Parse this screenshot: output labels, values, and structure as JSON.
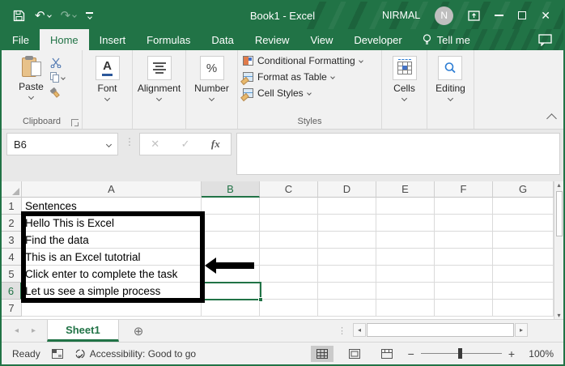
{
  "colors": {
    "accent": "#217346",
    "annotation": "#000000"
  },
  "titlebar": {
    "title": "Book1  -  Excel",
    "user": "NIRMAL",
    "avatar": "N"
  },
  "tabs": {
    "items": [
      "File",
      "Home",
      "Insert",
      "Formulas",
      "Data",
      "Review",
      "View",
      "Developer"
    ],
    "active": "Home",
    "tell_me": "Tell me"
  },
  "ribbon": {
    "paste": "Paste",
    "clipboard": "Clipboard",
    "font": "Font",
    "font_glyph": "A",
    "alignment": "Alignment",
    "number": "Number",
    "number_glyph": "%",
    "styles_items": [
      "Conditional Formatting",
      "Format as Table",
      "Cell Styles"
    ],
    "styles": "Styles",
    "cells": "Cells",
    "editing": "Editing"
  },
  "formula": {
    "name_box": "B6",
    "fx_label": "fx",
    "value": ""
  },
  "grid": {
    "columns": [
      "A",
      "B",
      "C",
      "D",
      "E",
      "F",
      "G"
    ],
    "active_column": "B",
    "active_row": "6",
    "rows": [
      {
        "num": "1",
        "a": "Sentences"
      },
      {
        "num": "2",
        "a": "Hello This is Excel"
      },
      {
        "num": "3",
        "a": "Find the data"
      },
      {
        "num": "4",
        "a": "This is an Excel tutotrial"
      },
      {
        "num": "5",
        "a": "Click enter to complete the task"
      },
      {
        "num": "6",
        "a": "Let us see a simple process"
      },
      {
        "num": "7",
        "a": ""
      }
    ]
  },
  "sheetbar": {
    "sheet": "Sheet1"
  },
  "statusbar": {
    "mode": "Ready",
    "accessibility": "Accessibility: Good to go",
    "zoom_minus": "−",
    "zoom_plus": "+",
    "zoom_level": "100%"
  },
  "icons": {
    "undo": "↶",
    "redo": "↷",
    "cancel": "✕",
    "enter": "✓",
    "up": "▴",
    "down": "▾",
    "left": "◂",
    "right": "▸",
    "dots": "⋮",
    "add": "⊕"
  }
}
